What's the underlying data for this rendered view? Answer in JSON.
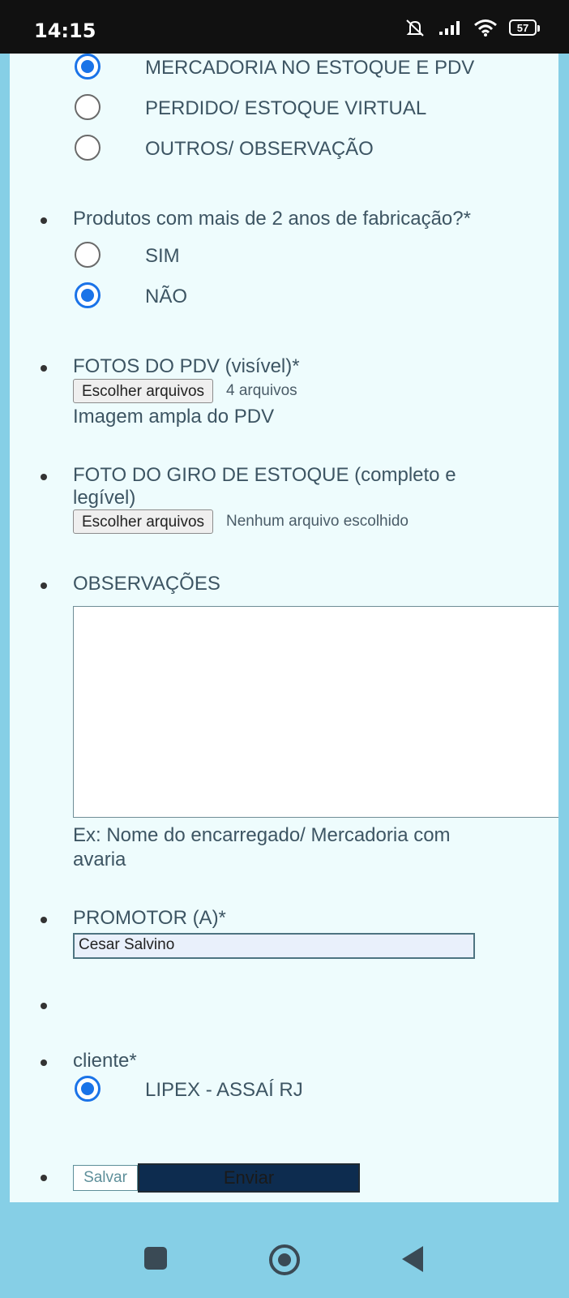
{
  "status_bar": {
    "time": "14:15",
    "battery": "57",
    "icons": [
      "mute-icon",
      "signal-icon",
      "wifi-icon",
      "battery-icon"
    ]
  },
  "estoque_group": {
    "options": [
      {
        "label": "MERCADORIA NO ESTOQUE E PDV",
        "checked": true
      },
      {
        "label": "PERDIDO/ ESTOQUE VIRTUAL",
        "checked": false
      },
      {
        "label": "OUTROS/ OBSERVAÇÃO",
        "checked": false
      }
    ]
  },
  "fabricacao": {
    "question": "Produtos com mais de 2 anos de fabricação?*",
    "options": [
      {
        "label": "SIM",
        "checked": false
      },
      {
        "label": "NÃO",
        "checked": true
      }
    ]
  },
  "fotos_pdv": {
    "label": "FOTOS DO PDV (visível)*",
    "button": "Escolher arquivos",
    "status": "4 arquivos",
    "hint": "Imagem ampla do PDV"
  },
  "foto_giro": {
    "label_line1": "FOTO DO GIRO DE ESTOQUE (completo e",
    "label_line2": "legível)",
    "button": "Escolher arquivos",
    "status": "Nenhum arquivo escolhido"
  },
  "observacoes": {
    "label": "OBSERVAÇÕES",
    "value": "",
    "hint_line1": "Ex: Nome do encarregado/ Mercadoria com",
    "hint_line2": "avaria"
  },
  "promotor": {
    "label": "PROMOTOR (A)*",
    "value": "Cesar Salvino"
  },
  "cliente": {
    "label": "cliente*",
    "options": [
      {
        "label": "LIPEX - ASSAÍ RJ",
        "checked": true
      }
    ]
  },
  "actions": {
    "save": "Salvar",
    "submit": "Enviar"
  },
  "colors": {
    "accent": "#1a73e8",
    "submit_bg": "#0d2c4f",
    "page_bg": "#86cfe6",
    "card_bg": "#eefcfd"
  }
}
